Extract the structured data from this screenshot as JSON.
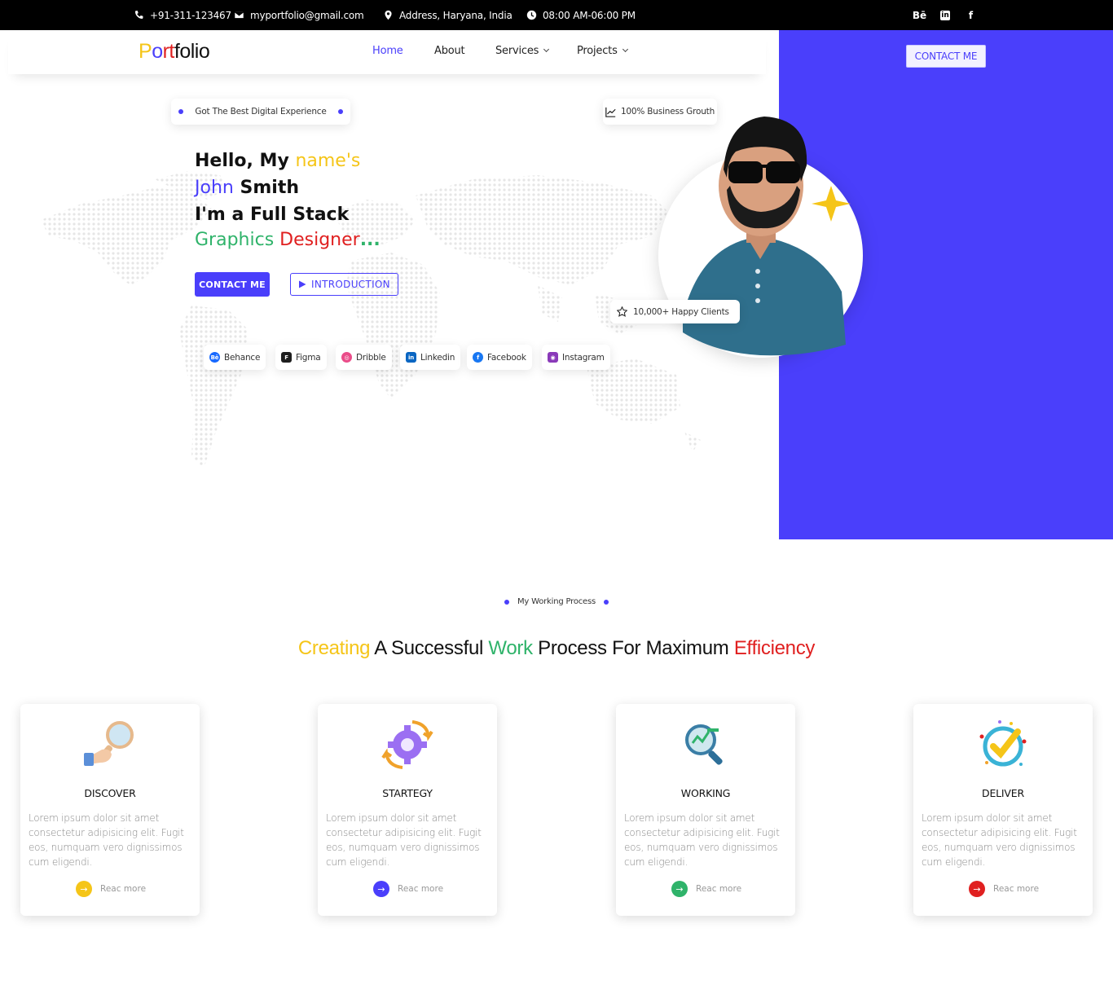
{
  "topbar": {
    "phone": "+91-311-123467",
    "email": "myportfolio@gmail.com",
    "address": "Address, Haryana, India",
    "hours": "08:00 AM-06:00 PM",
    "social": [
      {
        "icon": "behance-icon",
        "glyph": "Bē"
      },
      {
        "icon": "linkedin-icon",
        "glyph": "in"
      },
      {
        "icon": "facebook-icon",
        "glyph": "f"
      }
    ]
  },
  "header": {
    "logo": {
      "p": "P",
      "o": "o",
      "rt": "rt",
      "folio": "folio"
    },
    "nav": [
      {
        "label": "Home",
        "active": true
      },
      {
        "label": "About",
        "active": false
      },
      {
        "label": "Services",
        "dropdown": true
      },
      {
        "label": "Projects",
        "dropdown": true
      }
    ],
    "contact_button": "CONTACT ME"
  },
  "hero": {
    "badge": "Got The Best Digital Experience",
    "growth_badge": "100% Business Grouth",
    "clients_badge": "10,000+ Happy Clients",
    "line1_a": "Hello, My ",
    "line1_b": "name's",
    "line2_a": "John",
    "line2_b": " Smith",
    "line3": "I'm a Full Stack",
    "line4_a": "Graphics",
    "line4_b": " Designer",
    "line4_c": "...",
    "contact_button": "CONTACT ME",
    "intro_button": "INTRODUCTION",
    "socials": [
      {
        "label": "Behance",
        "icon": "behance-icon",
        "color": "#1769ff",
        "glyph": "Bē"
      },
      {
        "label": "Figma",
        "icon": "figma-icon",
        "color": "#1e1e1e",
        "glyph": "F"
      },
      {
        "label": "Dribble",
        "icon": "dribbble-icon",
        "color": "#ea4c89",
        "glyph": "◎"
      },
      {
        "label": "Linkedin",
        "icon": "linkedin-icon",
        "color": "#0a66c2",
        "glyph": "in"
      },
      {
        "label": "Facebook",
        "icon": "facebook-icon",
        "color": "#1877f2",
        "glyph": "f"
      },
      {
        "label": "Instagram",
        "icon": "instagram-icon",
        "color": "#8a3ab9",
        "glyph": "◉"
      }
    ]
  },
  "process": {
    "label": "My Working Process",
    "title": {
      "w1": "Creating",
      "w2": " A Successful ",
      "w3": "Work",
      "w4": " Process For Maximum ",
      "w5": "Efficiency"
    },
    "cards": [
      {
        "title": "DISCOVER",
        "icon": "magnifier-hand-icon",
        "desc": "Lorem ipsum dolor sit amet consectetur adipisicing elit. Fugit eos, numquam vero dignissimos cum eligendi.",
        "more": "Reac more",
        "accent": "#f5c518"
      },
      {
        "title": "STARTEGY",
        "icon": "gear-arrows-icon",
        "desc": "Lorem ipsum dolor sit amet consectetur adipisicing elit. Fugit eos, numquam vero dignissimos cum eligendi.",
        "more": "Reac more",
        "accent": "#4a3ffb"
      },
      {
        "title": "WORKING",
        "icon": "analytics-magnifier-icon",
        "desc": "Lorem ipsum dolor sit amet consectetur adipisicing elit. Fugit eos, numquam vero dignissimos cum eligendi.",
        "more": "Reac more",
        "accent": "#2fb36a"
      },
      {
        "title": "DELIVER",
        "icon": "checkmark-badge-icon",
        "desc": "Lorem ipsum dolor sit amet consectetur adipisicing elit. Fugit eos, numquam vero dignissimos cum eligendi.",
        "more": "Reac more",
        "accent": "#e02020"
      }
    ]
  },
  "colors": {
    "brand": "#4a3ffb",
    "yellow": "#f5c518",
    "green": "#2fb36a",
    "red": "#e02020"
  }
}
